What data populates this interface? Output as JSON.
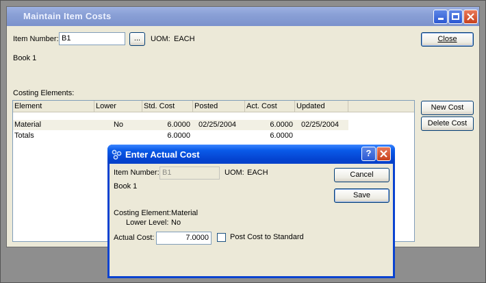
{
  "main_window": {
    "title": "Maintain Item Costs",
    "item_number_label": "Item Number:",
    "item_number_value": "B1",
    "browse_label": "...",
    "uom_label": "UOM:",
    "uom_value": "EACH",
    "description": "Book 1",
    "costing_elements_label": "Costing Elements:",
    "close_label": "Close",
    "new_cost_label": "New Cost",
    "delete_cost_label": "Delete Cost",
    "grid": {
      "columns": [
        "Element",
        "Lower",
        "Std. Cost",
        "Posted",
        "Act. Cost",
        "Updated"
      ],
      "rows": [
        {
          "element": "Material",
          "lower": "No",
          "std_cost": "6.0000",
          "posted": "02/25/2004",
          "act_cost": "6.0000",
          "updated": "02/25/2004"
        },
        {
          "element": "Totals",
          "lower": "",
          "std_cost": "6.0000",
          "posted": "",
          "act_cost": "6.0000",
          "updated": ""
        }
      ]
    }
  },
  "dialog": {
    "title": "Enter Actual Cost",
    "help_glyph": "?",
    "item_number_label": "Item Number:",
    "item_number_value": "B1",
    "uom_label": "UOM:",
    "uom_value": "EACH",
    "description": "Book 1",
    "costing_element_label": "Costing Element:",
    "costing_element_value": "Material",
    "lower_level_label": "Lower Level:",
    "lower_level_value": "No",
    "actual_cost_label": "Actual Cost:",
    "actual_cost_value": "7.0000",
    "post_to_standard_label": "Post Cost to Standard",
    "cancel_label": "Cancel",
    "save_label": "Save"
  },
  "colors": {
    "xp_blue": "#0842d1",
    "xp_face": "#ece9d8",
    "close_red": "#c7401c"
  }
}
